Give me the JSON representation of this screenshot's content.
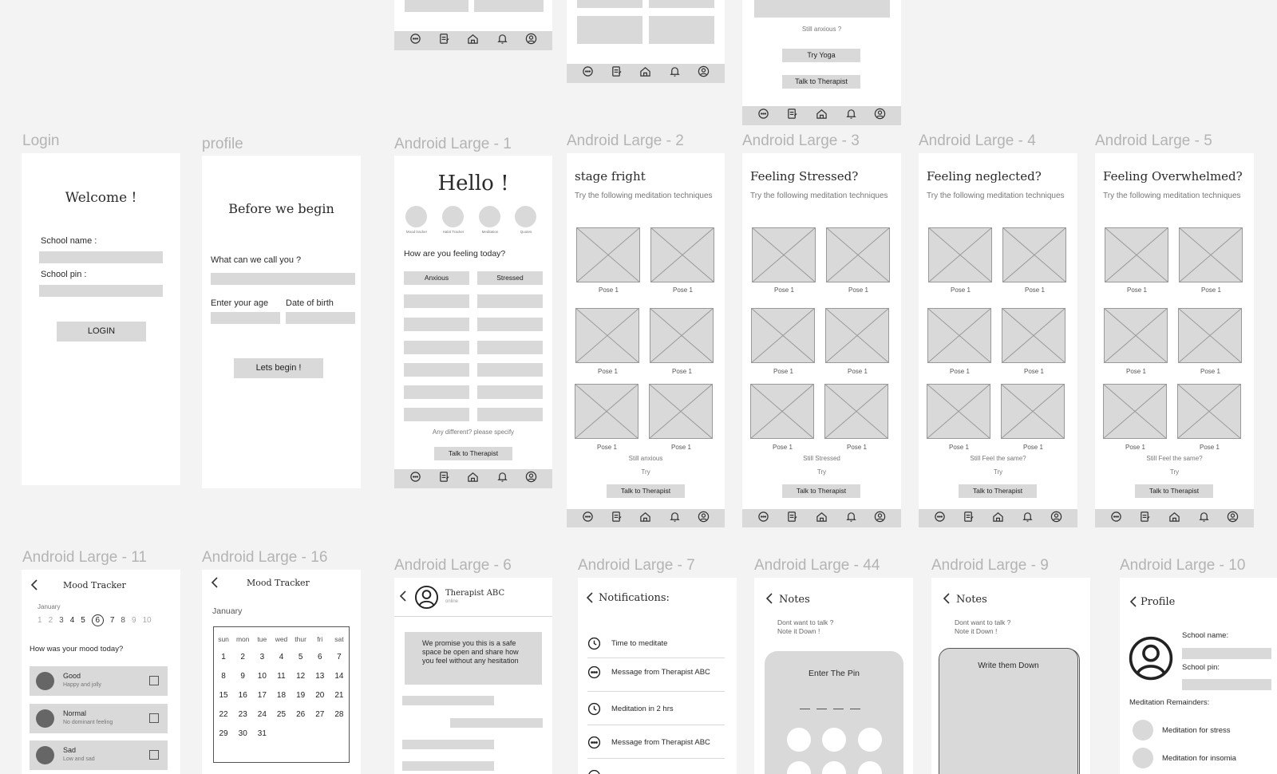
{
  "labels": {
    "login": "Login",
    "profile": "profile",
    "al1": "Android Large - 1",
    "al2": "Android Large - 2",
    "al3": "Android Large - 3",
    "al4": "Android Large - 4",
    "al5": "Android Large - 5",
    "al11": "Android Large - 11",
    "al16": "Android Large - 16",
    "al6": "Android Large - 6",
    "al7": "Android Large - 7",
    "al44": "Android Large - 44",
    "al9": "Android Large - 9",
    "al10": "Android Large - 10"
  },
  "top": {
    "still_anxious": "Still anxious ?",
    "try_yoga": "Try Yoga",
    "talk": "Talk to Therapist"
  },
  "login": {
    "welcome": "Welcome !",
    "school_name": "School name :",
    "school_pin": "School pin :",
    "login_btn": "LOGIN"
  },
  "profile": {
    "title": "Before we begin",
    "call_you": "What can we call you ?",
    "age": "Enter your age",
    "dob": "Date of birth",
    "begin_btn": "Lets begin !"
  },
  "home": {
    "hello": "Hello !",
    "shortcuts": [
      "Mood tracker",
      "Habit Tracker",
      "Meditation",
      "Quotes"
    ],
    "question": "How are you feeling today?",
    "opt1": "Anxious",
    "opt2": "Stressed",
    "other": "Any different? please specify",
    "talk": "Talk to Therapist"
  },
  "med": {
    "subtitle": "Try the following meditation techniques",
    "pose": "Pose 1",
    "try": "Try",
    "talk": "Talk to Therapist",
    "screens": [
      {
        "title": "stage fright",
        "still": "Still anxious"
      },
      {
        "title": "Feeling Stressed?",
        "still": "Still Stressed"
      },
      {
        "title": "Feeling neglected?",
        "still": "Still Feel the same?"
      },
      {
        "title": "Feeling Overwhelmed?",
        "still": "Still Feel the same?"
      }
    ]
  },
  "mood": {
    "title": "Mood Tracker",
    "month": "January",
    "days": [
      "1",
      "2",
      "3",
      "4",
      "5",
      "6",
      "7",
      "8",
      "9",
      "10"
    ],
    "question": "How was your mood today?",
    "items": [
      {
        "name": "Good",
        "desc": "Happy and jolly"
      },
      {
        "name": "Normal",
        "desc": "No dominant feeling"
      },
      {
        "name": "Sad",
        "desc": "Low and sad"
      }
    ]
  },
  "calendar": {
    "title": "Mood Tracker",
    "month": "January",
    "weekdays": [
      "sun",
      "mon",
      "tue",
      "wed",
      "thur",
      "fri",
      "sat"
    ],
    "weeks": [
      [
        "1",
        "2",
        "3",
        "4",
        "5",
        "6",
        "7"
      ],
      [
        "8",
        "9",
        "10",
        "11",
        "12",
        "13",
        "14"
      ],
      [
        "15",
        "16",
        "17",
        "18",
        "19",
        "20",
        "21"
      ],
      [
        "22",
        "23",
        "24",
        "25",
        "26",
        "27",
        "28"
      ],
      [
        "29",
        "30",
        "31"
      ]
    ]
  },
  "chat": {
    "name": "Therapist ABC",
    "status": "online",
    "message": "We promise you this is a safe space be open and share how you feel without any hesitation"
  },
  "notif": {
    "title": "Notifications:",
    "items": [
      {
        "icon": "clock-icon",
        "text": "Time to meditate"
      },
      {
        "icon": "message-icon",
        "text": "Message from Therapist ABC"
      },
      {
        "icon": "clock-icon",
        "text": "Meditation in 2 hrs"
      },
      {
        "icon": "message-icon",
        "text": "Message from Therapist ABC"
      }
    ]
  },
  "notes_pin": {
    "title": "Notes",
    "l1": "Dont want to talk ?",
    "l2": "Note it Down !",
    "pin": "Enter The Pin"
  },
  "notes": {
    "title": "Notes",
    "l1": "Dont want to talk ?",
    "l2": "Note it Down !",
    "write": "Write them Down"
  },
  "prof2": {
    "title": "Profile",
    "school_name": "School name:",
    "school_pin": "School pin:",
    "reminders": "Meditation Remainders:",
    "r1": "Meditation for stress",
    "r2": "Meditation for insomia"
  }
}
